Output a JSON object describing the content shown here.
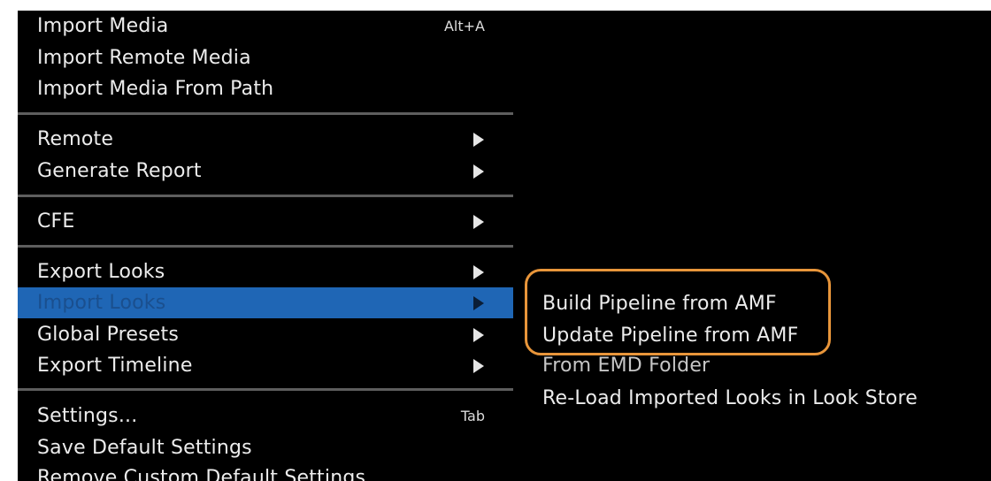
{
  "menu": {
    "items": [
      {
        "label": "Import Media",
        "shortcut": "Alt+A"
      },
      {
        "label": "Import Remote Media"
      },
      {
        "label": "Import Media From Path"
      },
      {
        "label": "Remote"
      },
      {
        "label": "Generate Report"
      },
      {
        "label": "CFE"
      },
      {
        "label": "Export Looks"
      },
      {
        "label": "Import Looks"
      },
      {
        "label": "Global Presets"
      },
      {
        "label": "Export Timeline"
      },
      {
        "label": "Settings...",
        "shortcut": "Tab"
      },
      {
        "label": "Save Default Settings"
      },
      {
        "label": "Remove Custom Default Settings"
      }
    ]
  },
  "submenu": {
    "items": [
      {
        "label": "Build Pipeline from AMF"
      },
      {
        "label": "Update Pipeline from AMF"
      },
      {
        "label": "From EMD Folder"
      },
      {
        "label": "Re-Load Imported Looks in Look Store"
      }
    ]
  },
  "colors": {
    "menu_background": "#000000",
    "highlight": "#1f66b5",
    "separator": "#5e5e5e",
    "callout_outline": "#e8953a",
    "text": "#ececec"
  },
  "icons": {
    "submenu_arrow": "triangle-right-icon"
  }
}
